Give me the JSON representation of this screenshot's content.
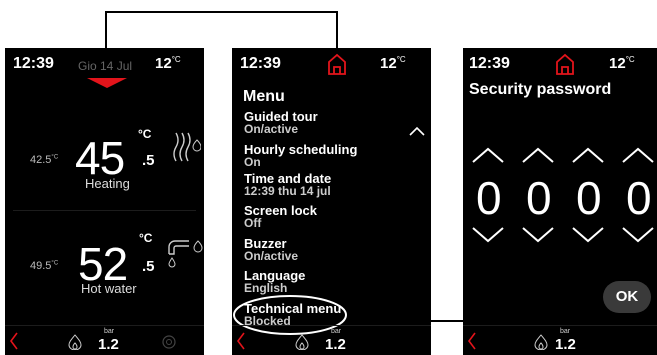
{
  "screen1": {
    "time": "12:39",
    "date": "Gio 14 Jul",
    "outdoor_temp": "12",
    "outdoor_unit": "°C",
    "heating": {
      "setpoint_ref": "42.5",
      "ref_unit": "°C",
      "value": "45",
      "unit": "°C",
      "decimal": ".5",
      "label": "Heating"
    },
    "hot_water": {
      "setpoint_ref": "49.5",
      "ref_unit": "°C",
      "value": "52",
      "unit": "°C",
      "decimal": ".5",
      "label": "Hot water"
    },
    "pressure_unit": "bar",
    "pressure_value": "1.2"
  },
  "screen2": {
    "time": "12:39",
    "outdoor_temp": "12",
    "outdoor_unit": "°C",
    "menu_title": "Menu",
    "items": [
      {
        "name": "Guided tour",
        "value": "On/active"
      },
      {
        "name": "Hourly scheduling",
        "value": "On"
      },
      {
        "name": "Time and date",
        "value": "12:39 thu 14 jul"
      },
      {
        "name": "Screen lock",
        "value": "Off"
      },
      {
        "name": "Buzzer",
        "value": "On/active"
      },
      {
        "name": "Language",
        "value": "English"
      },
      {
        "name": "Technical menu",
        "value": "Blocked"
      }
    ],
    "pressure_unit": "bar",
    "pressure_value": "1.2"
  },
  "screen3": {
    "time": "12:39",
    "outdoor_temp": "12",
    "outdoor_unit": "°C",
    "title": "Security password",
    "digits": [
      "0",
      "0",
      "0",
      "0"
    ],
    "ok_label": "OK",
    "pressure_unit": "bar",
    "pressure_value": "1.2"
  },
  "colors": {
    "accent": "#e3141b",
    "background": "#000000",
    "text": "#ffffff"
  },
  "icons": [
    "home-icon",
    "flame-icon",
    "back-arrow-icon",
    "radiator-icon",
    "tap-icon",
    "chevron-up-icon",
    "chevron-down-icon"
  ]
}
